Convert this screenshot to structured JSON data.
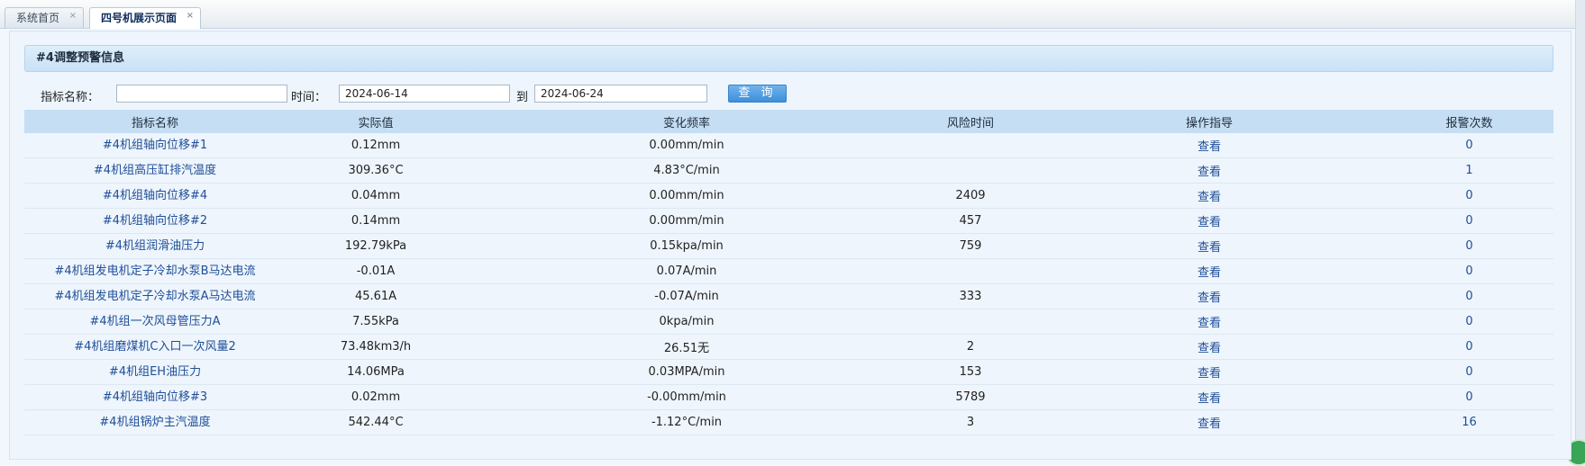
{
  "tabs": [
    {
      "label": "系统首页",
      "close": "×"
    },
    {
      "label": "四号机展示页面",
      "close": "×"
    }
  ],
  "panel": {
    "title": "#4调整预警信息"
  },
  "filters": {
    "name_label": "指标名称：",
    "name_value": "",
    "time_label": "时间：",
    "start_date": "2024-06-14",
    "to_label": "到",
    "end_date": "2024-06-24",
    "query_button": "查 询"
  },
  "table": {
    "headers": [
      "指标名称",
      "实际值",
      "变化频率",
      "风险时间",
      "操作指导",
      "报警次数"
    ],
    "rows": [
      {
        "name": "#4机组轴向位移#1",
        "value": "0.12mm",
        "rate": "0.00mm/min",
        "risk": "",
        "action": "查看",
        "count": "0"
      },
      {
        "name": "#4机组高压缸排汽温度",
        "value": "309.36°C",
        "rate": "4.83°C/min",
        "risk": "",
        "action": "查看",
        "count": "1"
      },
      {
        "name": "#4机组轴向位移#4",
        "value": "0.04mm",
        "rate": "0.00mm/min",
        "risk": "2409",
        "action": "查看",
        "count": "0"
      },
      {
        "name": "#4机组轴向位移#2",
        "value": "0.14mm",
        "rate": "0.00mm/min",
        "risk": "457",
        "action": "查看",
        "count": "0"
      },
      {
        "name": "#4机组润滑油压力",
        "value": "192.79kPa",
        "rate": "0.15kpa/min",
        "risk": "759",
        "action": "查看",
        "count": "0"
      },
      {
        "name": "#4机组发电机定子冷却水泵B马达电流",
        "value": "-0.01A",
        "rate": "0.07A/min",
        "risk": "",
        "action": "查看",
        "count": "0"
      },
      {
        "name": "#4机组发电机定子冷却水泵A马达电流",
        "value": "45.61A",
        "rate": "-0.07A/min",
        "risk": "333",
        "action": "查看",
        "count": "0"
      },
      {
        "name": "#4机组一次风母管压力A",
        "value": "7.55kPa",
        "rate": "0kpa/min",
        "risk": "",
        "action": "查看",
        "count": "0"
      },
      {
        "name": "#4机组磨煤机C入口一次风量2",
        "value": "73.48km3/h",
        "rate": "26.51无",
        "risk": "2",
        "action": "查看",
        "count": "0"
      },
      {
        "name": "#4机组EH油压力",
        "value": "14.06MPa",
        "rate": "0.03MPA/min",
        "risk": "153",
        "action": "查看",
        "count": "0"
      },
      {
        "name": "#4机组轴向位移#3",
        "value": "0.02mm",
        "rate": "-0.00mm/min",
        "risk": "5789",
        "action": "查看",
        "count": "0"
      },
      {
        "name": "#4机组锅炉主汽温度",
        "value": "542.44°C",
        "rate": "-1.12°C/min",
        "risk": "3",
        "action": "查看",
        "count": "16"
      }
    ]
  }
}
